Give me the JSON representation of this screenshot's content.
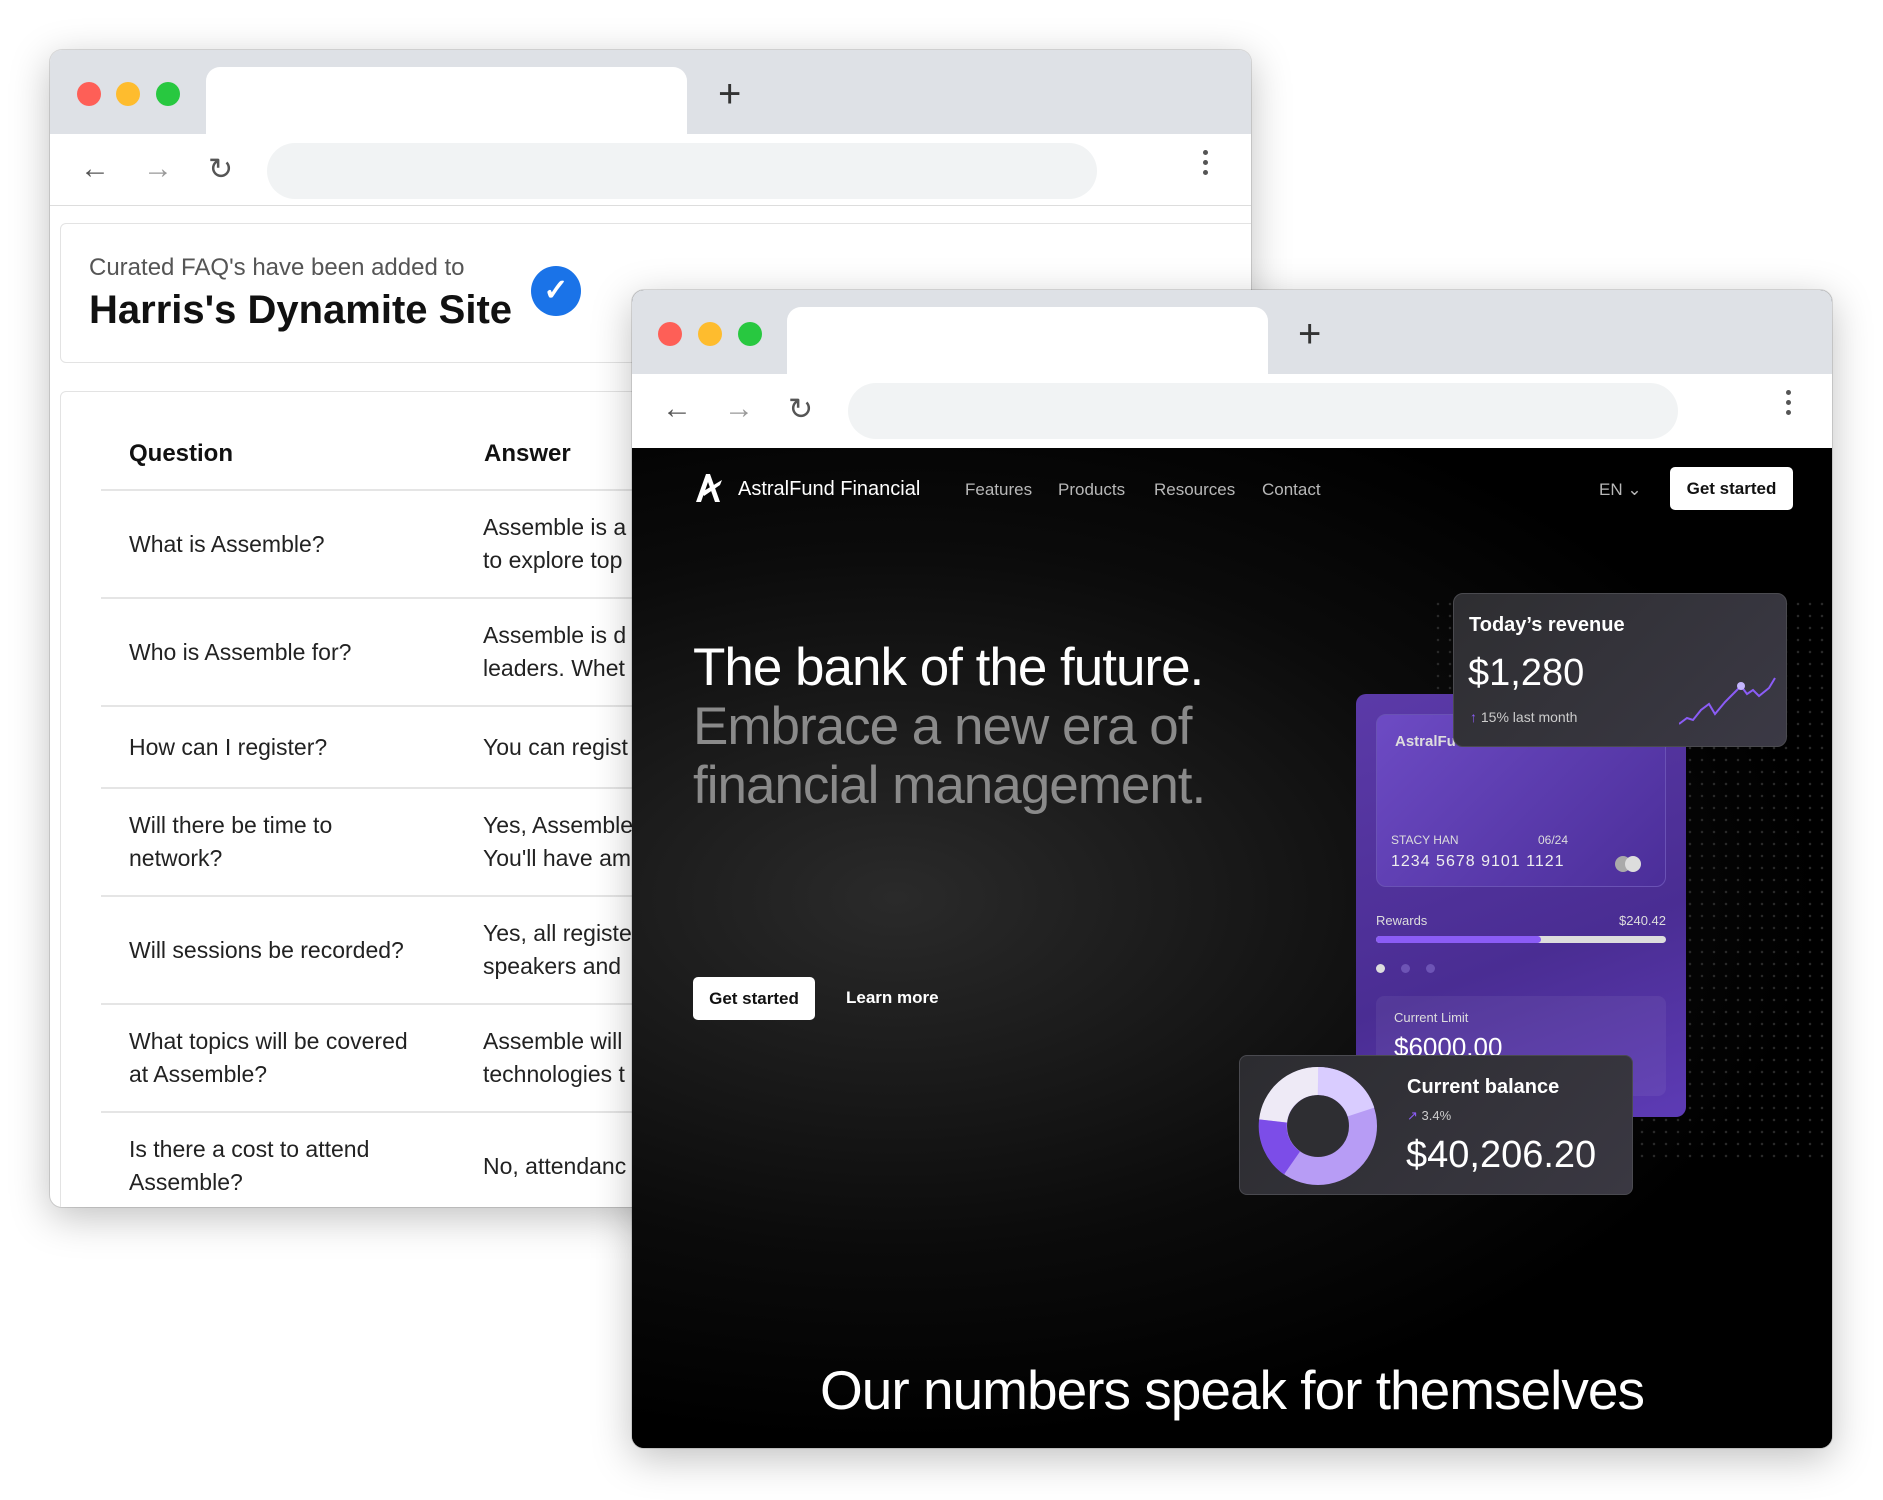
{
  "back_window": {
    "notice_subtitle": "Curated FAQ's have been added to",
    "site_title": "Harris's Dynamite Site",
    "table": {
      "headers": [
        "Question",
        "Answer"
      ],
      "rows": [
        {
          "q": "What is Assemble?",
          "a": "Assemble is a\nto explore top"
        },
        {
          "q": "Who is Assemble for?",
          "a": "Assemble is d\nleaders. Whet"
        },
        {
          "q": "How can I register?",
          "a": "You can regist"
        },
        {
          "q": "Will there be time to\nnetwork?",
          "a": "Yes, Assemble\nYou'll have am"
        },
        {
          "q": "Will sessions be recorded?",
          "a": "Yes, all registe\nspeakers and"
        },
        {
          "q": "What topics will be covered\nat Assemble?",
          "a": "Assemble will\ntechnologies t"
        },
        {
          "q": "Is there a cost to attend\nAssemble?",
          "a": "No, attendanc"
        }
      ]
    }
  },
  "front_window": {
    "brand": "AstralFund Financial",
    "nav": [
      "Features",
      "Products",
      "Resources",
      "Contact"
    ],
    "language": "EN",
    "nav_cta": "Get started",
    "hero_line1": "The bank of the future.",
    "hero_line2": "Embrace a new era of",
    "hero_line3": "financial management.",
    "cta_primary": "Get started",
    "cta_secondary": "Learn more",
    "revenue": {
      "title": "Today’s revenue",
      "value": "$1,280",
      "change": "15% last month"
    },
    "card": {
      "brand": "AstralFu",
      "holder": "STACY HAN",
      "expiry": "06/24",
      "number": "1234  5678  9101  1121",
      "rewards_label": "Rewards",
      "rewards_value": "$240.42",
      "rewards_progress_pct": 57,
      "limit_label": "Current Limit",
      "limit_value": "$6000.00"
    },
    "balance": {
      "title": "Current balance",
      "change": "3.4%",
      "value": "$40,206.20"
    },
    "section_title": "Our numbers speak for themselves",
    "accent": "#8b5cf6"
  }
}
